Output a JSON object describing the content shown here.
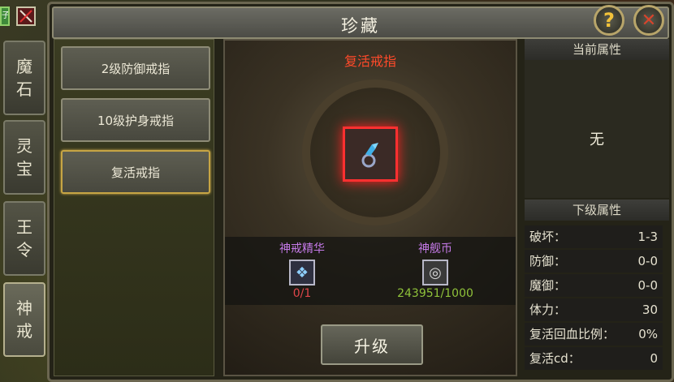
{
  "window": {
    "title": "珍藏"
  },
  "corner": {
    "left_label": "子"
  },
  "sidebar": {
    "tabs": [
      {
        "line1": "魔",
        "line2": "石"
      },
      {
        "line1": "灵",
        "line2": "宝"
      },
      {
        "line1": "王",
        "line2": "令"
      },
      {
        "line1": "神",
        "line2": "戒"
      }
    ]
  },
  "list": {
    "items": [
      "2级防御戒指",
      "10级护身戒指",
      "复活戒指"
    ],
    "selected_index": 2
  },
  "center": {
    "item_name": "复活戒指",
    "materials": [
      {
        "name": "神戒精华",
        "count": "0/1",
        "count_color": "#e0464a",
        "icon": "ring-essence-icon"
      },
      {
        "name": "神舰币",
        "count": "243951/1000",
        "count_color": "#8fc23a",
        "icon": "coin-icon"
      }
    ],
    "upgrade_label": "升级"
  },
  "current_attrs": {
    "header": "当前属性",
    "value": "无"
  },
  "next_attrs": {
    "header": "下级属性",
    "rows": [
      {
        "label": "破坏：",
        "value": "1-3"
      },
      {
        "label": "防御：",
        "value": "0-0"
      },
      {
        "label": "魔御：",
        "value": "0-0"
      },
      {
        "label": "体力：",
        "value": "30"
      },
      {
        "label": "复活回血比例：",
        "value": "0%"
      },
      {
        "label": "复活cd：",
        "value": "0"
      }
    ]
  },
  "colors": {
    "accent_gold": "#c7a544",
    "item_red": "#ff4a2a",
    "material_purple": "#c57ae8"
  }
}
